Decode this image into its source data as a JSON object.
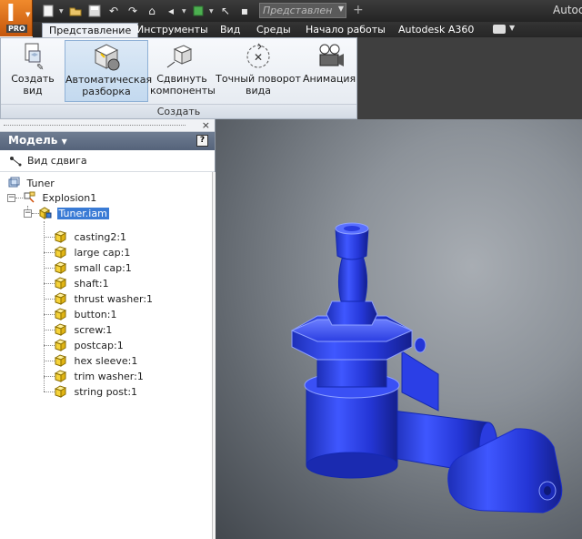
{
  "app": {
    "window_title": "Autoc",
    "logo_letter": "I",
    "logo_edition": "PRO"
  },
  "quick_access": {
    "combo_value": "Представлен"
  },
  "tabs": [
    {
      "label": "Представление",
      "active": true
    },
    {
      "label": "Инструменты",
      "active": false
    },
    {
      "label": "Вид",
      "active": false
    },
    {
      "label": "Среды",
      "active": false
    },
    {
      "label": "Начало работы",
      "active": false
    },
    {
      "label": "Autodesk A360",
      "active": false
    }
  ],
  "ribbon": {
    "panel_label": "Создать",
    "buttons": [
      {
        "label": "Создать вид",
        "icon": "create-view-icon"
      },
      {
        "label": "Автоматическая разборка",
        "icon": "auto-explode-icon",
        "active": true
      },
      {
        "label": "Сдвинуть компоненты",
        "icon": "tweak-components-icon"
      },
      {
        "label": "Точный поворот вида",
        "icon": "precise-rotate-icon"
      },
      {
        "label": "Анимация",
        "icon": "animation-icon"
      }
    ]
  },
  "browser": {
    "title": "Модель",
    "help": "?",
    "close": "×",
    "view_label": "Вид сдвига",
    "tree": {
      "root": "Tuner",
      "explosion": "Explosion1",
      "assembly": "Tuner.iam",
      "parts": [
        "casting2:1",
        "large cap:1",
        "small cap:1",
        "shaft:1",
        "thrust washer:1",
        "button:1",
        "screw:1",
        "postcap:1",
        "hex sleeve:1",
        "trim washer:1",
        "string post:1"
      ]
    }
  },
  "colors": {
    "model_blue": "#2a3fe0",
    "selection": "#3a7bd5",
    "header_bg": "#5f6d83"
  }
}
